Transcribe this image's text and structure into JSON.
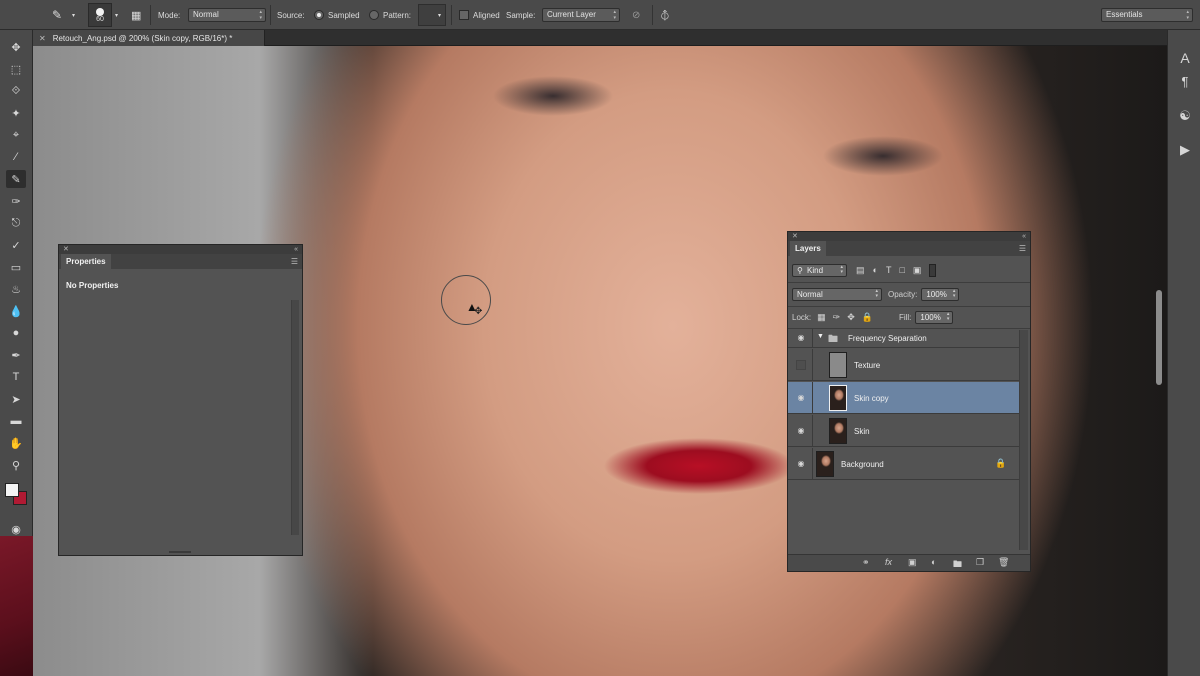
{
  "options_bar": {
    "brush_size": "60",
    "mode_label": "Mode:",
    "mode_value": "Normal",
    "source_label": "Source:",
    "sampled_label": "Sampled",
    "pattern_label": "Pattern:",
    "aligned_label": "Aligned",
    "sample_label": "Sample:",
    "sample_value": "Current Layer",
    "workspace": "Essentials"
  },
  "document_tab": {
    "title": "Retouch_Ang.psd @ 200% (Skin copy, RGB/16*) *"
  },
  "tools": [
    "move-tool",
    "marquee-tool",
    "lasso-tool",
    "quick-selection-tool",
    "crop-tool",
    "eyedropper-tool",
    "healing-brush-tool",
    "brush-tool",
    "clone-stamp-tool",
    "history-brush-tool",
    "eraser-tool",
    "paint-bucket-tool",
    "blur-tool",
    "dodge-tool",
    "pen-tool",
    "type-tool",
    "path-selection-tool",
    "rectangle-tool",
    "hand-tool",
    "zoom-tool"
  ],
  "colors": {
    "foreground": "#f4f4f4",
    "background": "#b01a33",
    "selected_layer": "#6b84a3"
  },
  "properties_panel": {
    "tab": "Properties",
    "empty_text": "No Properties"
  },
  "layers_panel": {
    "tab": "Layers",
    "filter_label": "Kind",
    "blend_mode": "Normal",
    "opacity_label": "Opacity:",
    "opacity_value": "100%",
    "lock_label": "Lock:",
    "fill_label": "Fill:",
    "fill_value": "100%",
    "layers": [
      {
        "name": "Frequency Separation",
        "type": "group",
        "visible": true,
        "selected": false
      },
      {
        "name": "Texture",
        "type": "layer",
        "visible": false,
        "selected": false
      },
      {
        "name": "Skin copy",
        "type": "layer",
        "visible": true,
        "selected": true
      },
      {
        "name": "Skin",
        "type": "layer",
        "visible": true,
        "selected": false
      },
      {
        "name": "Background",
        "type": "layer",
        "visible": true,
        "selected": false,
        "locked": true
      }
    ]
  }
}
